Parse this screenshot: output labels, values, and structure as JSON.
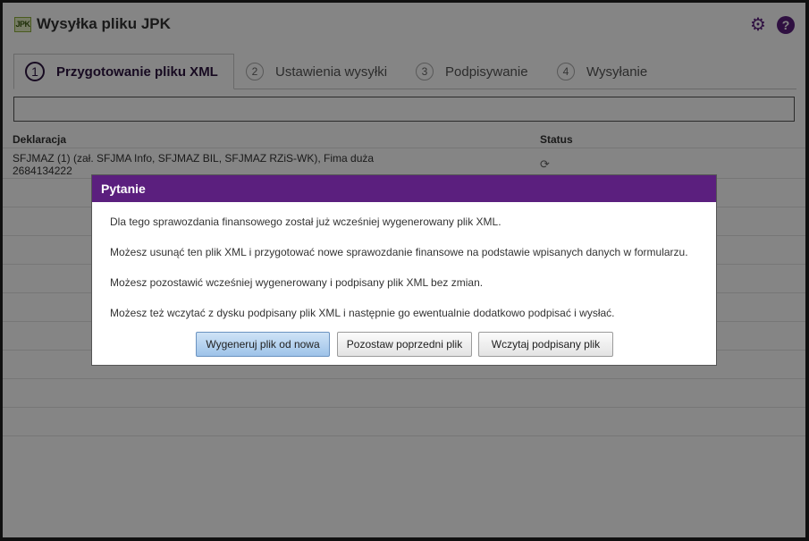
{
  "app": {
    "icon_text": "JPK",
    "title": "Wysyłka pliku JPK"
  },
  "tabs": [
    {
      "num": "1",
      "label": "Przygotowanie pliku XML"
    },
    {
      "num": "2",
      "label": "Ustawienia wysyłki"
    },
    {
      "num": "3",
      "label": "Podpisywanie"
    },
    {
      "num": "4",
      "label": "Wysyłanie"
    }
  ],
  "table": {
    "headers": [
      "Deklaracja",
      "Status"
    ],
    "rows": [
      {
        "line1": "SFJMAZ (1) (zał. SFJMA Info, SFJMAZ BIL, SFJMAZ RZiS-WK), Fima duża",
        "line2": "2684134222",
        "status_icon": "loading-spinner-icon"
      }
    ]
  },
  "dialog": {
    "title": "Pytanie",
    "messages": [
      "Dla tego sprawozdania finansowego został już wcześniej wygenerowany plik XML.",
      "Możesz usunąć ten plik XML i przygotować nowe sprawozdanie finansowe na podstawie wpisanych danych w formularzu.",
      "Możesz pozostawić wcześniej wygenerowany i podpisany plik XML bez zmian.",
      "Możesz też wczytać z dysku podpisany plik XML i następnie go ewentualnie dodatkowo podpisać i wysłać."
    ],
    "buttons": {
      "regenerate": "Wygeneruj plik od nowa",
      "keep": "Pozostaw poprzedni plik",
      "load": "Wczytaj podpisany plik"
    }
  },
  "colors": {
    "accent": "#5b1f7e",
    "active_tab_text": "#2d1540",
    "primary_button": "#9ec3e9"
  }
}
